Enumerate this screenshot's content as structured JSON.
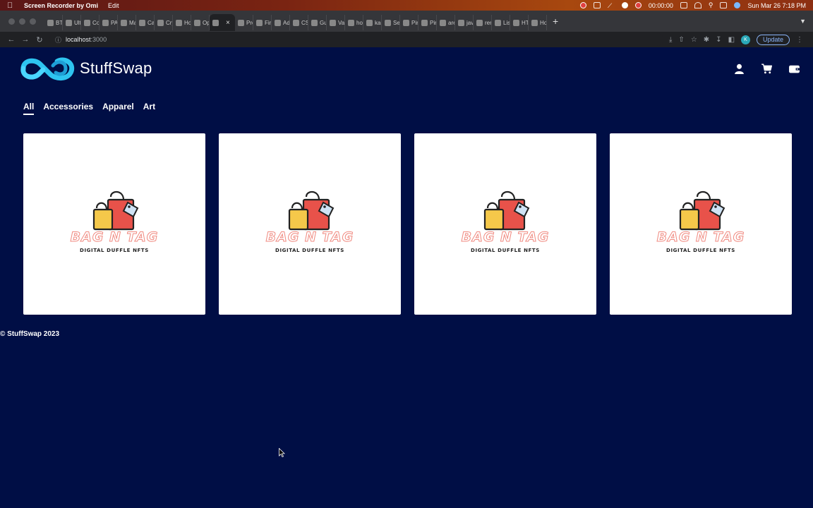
{
  "system_menubar": {
    "app_name": "Screen Recorder by Omi",
    "menu_item": "Edit",
    "recording_time": "00:00:00",
    "clock": "Sun Mar 26  7:18 PM"
  },
  "browser": {
    "tabs": [
      {
        "label": "BT"
      },
      {
        "label": "Ult"
      },
      {
        "label": "Co"
      },
      {
        "label": "PA"
      },
      {
        "label": "Ma"
      },
      {
        "label": "Ca"
      },
      {
        "label": "Cry"
      },
      {
        "label": "Ho"
      },
      {
        "label": "Op"
      },
      {
        "label": "",
        "active": true
      },
      {
        "label": "Pro"
      },
      {
        "label": "Fin"
      },
      {
        "label": "Ad"
      },
      {
        "label": "CS"
      },
      {
        "label": "Gu"
      },
      {
        "label": "Va"
      },
      {
        "label": "ho"
      },
      {
        "label": "kas"
      },
      {
        "label": "Se"
      },
      {
        "label": "Pin"
      },
      {
        "label": "Pin"
      },
      {
        "label": "are"
      },
      {
        "label": "jav"
      },
      {
        "label": "ren"
      },
      {
        "label": "Lis"
      },
      {
        "label": "HT"
      },
      {
        "label": "Ho"
      }
    ],
    "url_host": "localhost",
    "url_port": ":3000",
    "update_label": "Update",
    "profile_initial": "K"
  },
  "site": {
    "brand_name": "StuffSwap",
    "categories": [
      {
        "label": "All",
        "active": true
      },
      {
        "label": "Accessories"
      },
      {
        "label": "Apparel"
      },
      {
        "label": "Art"
      }
    ],
    "cards": [
      {
        "title": "BAG N TAG",
        "subtitle": "DIGITAL DUFFLE NFTS"
      },
      {
        "title": "BAG N TAG",
        "subtitle": "DIGITAL DUFFLE NFTS"
      },
      {
        "title": "BAG N TAG",
        "subtitle": "DIGITAL DUFFLE NFTS"
      },
      {
        "title": "BAG N TAG",
        "subtitle": "DIGITAL DUFFLE NFTS"
      }
    ],
    "footer": "© StuffSwap 2023",
    "colors": {
      "background": "#000e45",
      "logo_cyan": "#2ec4f0",
      "bag_red": "#e8524a",
      "bag_yellow": "#f5c84a",
      "title_outline": "#f08a80"
    }
  }
}
